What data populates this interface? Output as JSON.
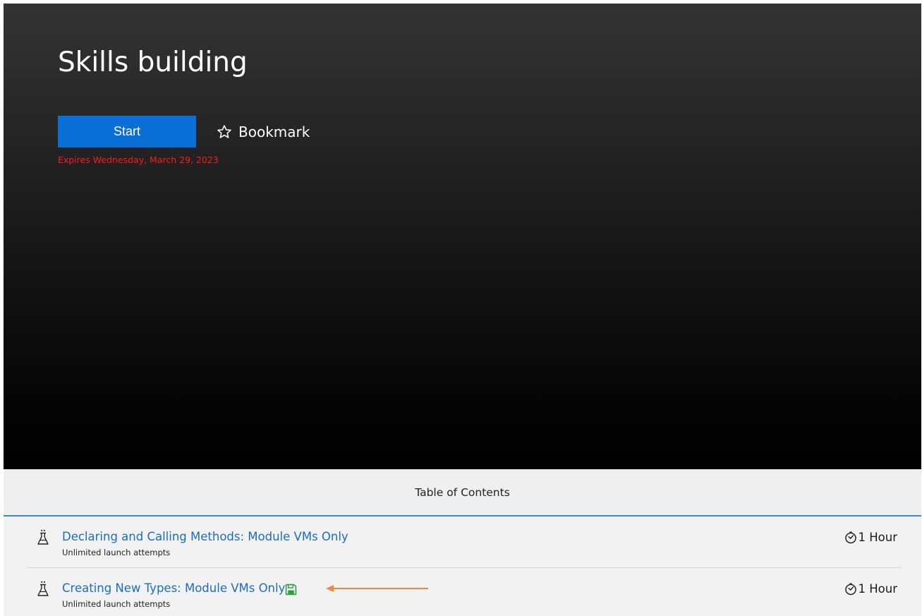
{
  "hero": {
    "title": "Skills building",
    "start_label": "Start",
    "bookmark_label": "Bookmark",
    "bookmark_icon": "star-outline-icon",
    "expires_text": "Expires Wednesday, March 29, 2023"
  },
  "toc": {
    "header": "Table of Contents",
    "items": [
      {
        "title": "Declaring and Calling Methods: Module VMs Only",
        "subtitle": "Unlimited launch attempts",
        "duration": "1 Hour",
        "icon": "lab-flask-icon"
      },
      {
        "title": "Creating New Types: Module VMs Only",
        "subtitle": "Unlimited launch attempts",
        "duration": "1 Hour",
        "icon": "lab-flask-icon",
        "badge_icon": "save-icon"
      }
    ]
  },
  "colors": {
    "start_button": "#0a6fd6",
    "expires_text": "#ff1a1a",
    "link": "#1a6dc4",
    "save_icon": "#2e9e3e",
    "annotation_arrow": "#f0883e",
    "toc_header_border": "#3e86d0"
  }
}
